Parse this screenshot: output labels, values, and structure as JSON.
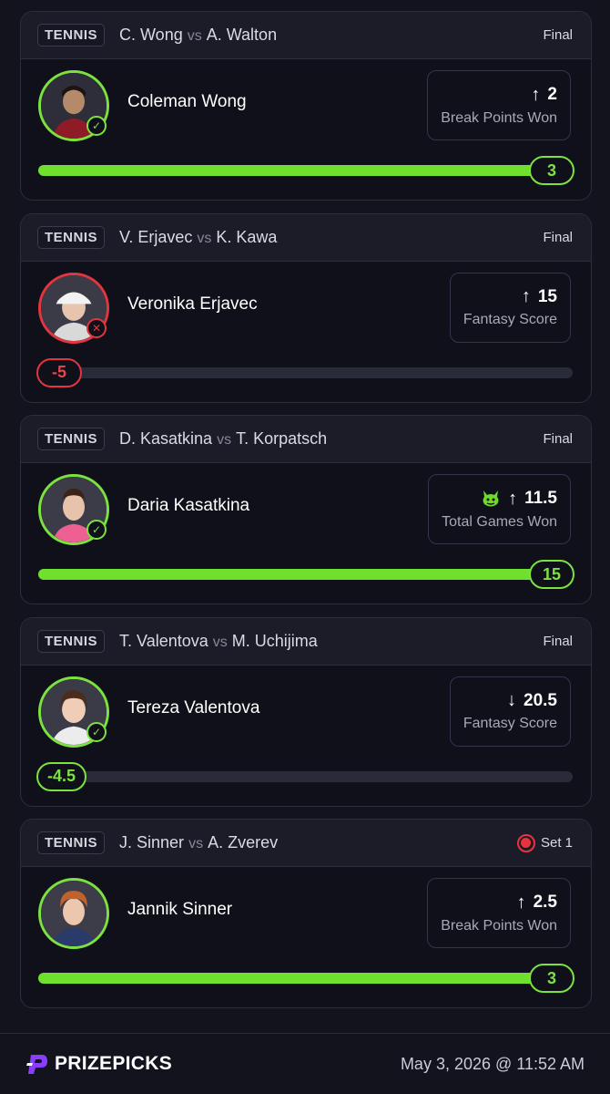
{
  "colors": {
    "win": "#7ce23f",
    "loss": "#e2353f",
    "bar_fill": "#6fe02d",
    "brand": "#8b3dff"
  },
  "cards": [
    {
      "sport": "TENNIS",
      "player_a": "C. Wong",
      "vs": "vs",
      "player_b": "A. Walton",
      "status": "Final",
      "player_name": "Coleman Wong",
      "result": "win",
      "direction_icon": "arrow-up-icon",
      "arrow": "↑",
      "line": "2",
      "stat_label": "Break Points Won",
      "has_demon": false,
      "actual": "3",
      "progress": 1.0
    },
    {
      "sport": "TENNIS",
      "player_a": "V. Erjavec",
      "vs": "vs",
      "player_b": "K. Kawa",
      "status": "Final",
      "player_name": "Veronika Erjavec",
      "result": "loss",
      "direction_icon": "arrow-up-icon",
      "arrow": "↑",
      "line": "15",
      "stat_label": "Fantasy Score",
      "has_demon": false,
      "actual": "-5",
      "progress": 0.0
    },
    {
      "sport": "TENNIS",
      "player_a": "D. Kasatkina",
      "vs": "vs",
      "player_b": "T. Korpatsch",
      "status": "Final",
      "player_name": "Daria Kasatkina",
      "result": "win",
      "direction_icon": "arrow-up-icon",
      "arrow": "↑",
      "line": "11.5",
      "stat_label": "Total Games Won",
      "has_demon": true,
      "actual": "15",
      "progress": 1.0
    },
    {
      "sport": "TENNIS",
      "player_a": "T. Valentova",
      "vs": "vs",
      "player_b": "M. Uchijima",
      "status": "Final",
      "player_name": "Tereza Valentova",
      "result": "win",
      "direction_icon": "arrow-down-icon",
      "arrow": "↓",
      "line": "20.5",
      "stat_label": "Fantasy Score",
      "has_demon": false,
      "actual": "-4.5",
      "progress": 0.0
    },
    {
      "sport": "TENNIS",
      "player_a": "J. Sinner",
      "vs": "vs",
      "player_b": "A. Zverev",
      "status": "Set 1",
      "live": true,
      "player_name": "Jannik Sinner",
      "result": "none",
      "direction_icon": "arrow-up-icon",
      "arrow": "↑",
      "line": "2.5",
      "stat_label": "Break Points Won",
      "has_demon": false,
      "actual": "3",
      "progress": 1.0
    }
  ],
  "footer": {
    "brand": "PRIZEPICKS",
    "timestamp": "May 3, 2026 @ 11:52 AM"
  }
}
